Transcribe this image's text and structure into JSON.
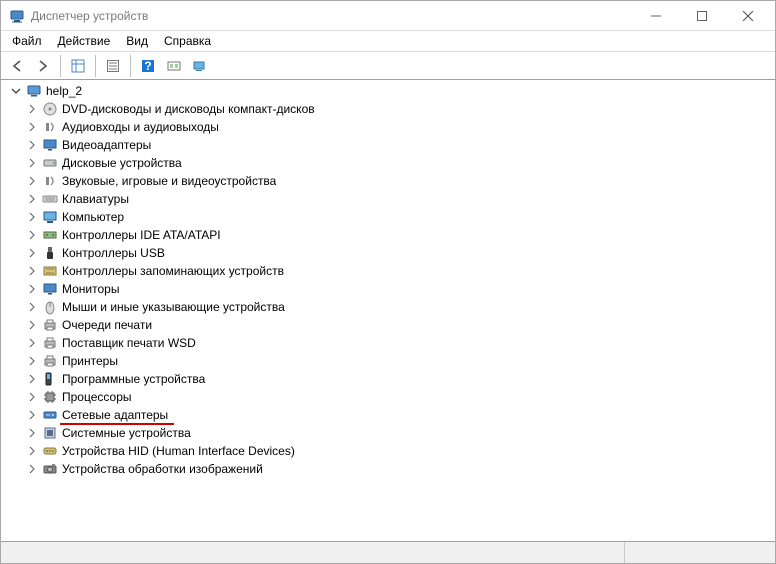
{
  "window": {
    "title": "Диспетчер устройств"
  },
  "menu": {
    "file": "Файл",
    "action": "Действие",
    "view": "Вид",
    "help": "Справка"
  },
  "tree": {
    "root": {
      "label": "help_2",
      "expanded": true
    },
    "categories": [
      {
        "label": "DVD-дисководы и дисководы компакт-дисков",
        "icon": "disc"
      },
      {
        "label": "Аудиовходы и аудиовыходы",
        "icon": "audio"
      },
      {
        "label": "Видеоадаптеры",
        "icon": "display"
      },
      {
        "label": "Дисковые устройства",
        "icon": "disk"
      },
      {
        "label": "Звуковые, игровые и видеоустройства",
        "icon": "audio"
      },
      {
        "label": "Клавиатуры",
        "icon": "keyboard"
      },
      {
        "label": "Компьютер",
        "icon": "computer"
      },
      {
        "label": "Контроллеры IDE ATA/ATAPI",
        "icon": "ide"
      },
      {
        "label": "Контроллеры USB",
        "icon": "usb"
      },
      {
        "label": "Контроллеры запоминающих устройств",
        "icon": "storagectl"
      },
      {
        "label": "Мониторы",
        "icon": "monitor"
      },
      {
        "label": "Мыши и иные указывающие устройства",
        "icon": "mouse"
      },
      {
        "label": "Очереди печати",
        "icon": "printq"
      },
      {
        "label": "Поставщик печати WSD",
        "icon": "printq"
      },
      {
        "label": "Принтеры",
        "icon": "printq"
      },
      {
        "label": "Программные устройства",
        "icon": "software"
      },
      {
        "label": "Процессоры",
        "icon": "cpu"
      },
      {
        "label": "Сетевые адаптеры",
        "icon": "network",
        "highlight": true
      },
      {
        "label": "Системные устройства",
        "icon": "system"
      },
      {
        "label": "Устройства HID (Human Interface Devices)",
        "icon": "hid"
      },
      {
        "label": "Устройства обработки изображений",
        "icon": "imaging"
      }
    ]
  }
}
